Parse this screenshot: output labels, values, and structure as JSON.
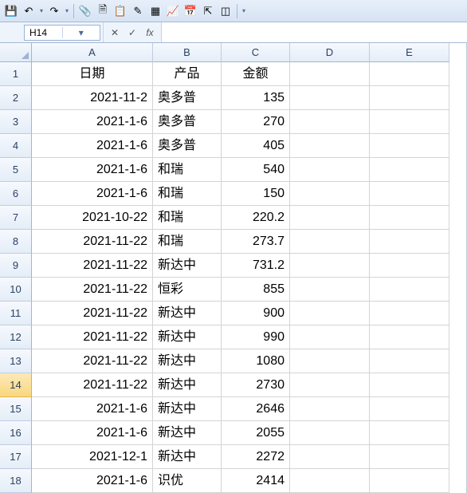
{
  "toolbar": {
    "icons": [
      "save-icon",
      "undo-icon",
      "undo-drop",
      "redo-icon",
      "redo-drop",
      "sep",
      "attach-icon",
      "new-doc-icon",
      "paste-icon",
      "rename-icon",
      "table-icon",
      "chart-icon",
      "calendar-icon",
      "export-icon",
      "template-icon",
      "sep",
      "overflow-drop"
    ]
  },
  "refbar": {
    "cell_ref": "H14",
    "fx_label": "fx",
    "formula": ""
  },
  "columns": [
    "A",
    "B",
    "C",
    "D",
    "E"
  ],
  "active_row": 14,
  "headers": {
    "A": "日期",
    "B": "产品",
    "C": "金额"
  },
  "chart_data": {
    "type": "table",
    "columns": [
      "日期",
      "产品",
      "金额"
    ],
    "rows": [
      {
        "日期": "2021-11-2",
        "产品": "奥多普",
        "金额": 135
      },
      {
        "日期": "2021-1-6",
        "产品": "奥多普",
        "金额": 270
      },
      {
        "日期": "2021-1-6",
        "产品": "奥多普",
        "金额": 405
      },
      {
        "日期": "2021-1-6",
        "产品": "和瑞",
        "金额": 540
      },
      {
        "日期": "2021-1-6",
        "产品": "和瑞",
        "金额": 150
      },
      {
        "日期": "2021-10-22",
        "产品": "和瑞",
        "金额": 220.2
      },
      {
        "日期": "2021-11-22",
        "产品": "和瑞",
        "金额": 273.7
      },
      {
        "日期": "2021-11-22",
        "产品": "新达中",
        "金额": 731.2
      },
      {
        "日期": "2021-11-22",
        "产品": "恒彩",
        "金额": 855
      },
      {
        "日期": "2021-11-22",
        "产品": "新达中",
        "金额": 900
      },
      {
        "日期": "2021-11-22",
        "产品": "新达中",
        "金额": 990
      },
      {
        "日期": "2021-11-22",
        "产品": "新达中",
        "金额": 1080
      },
      {
        "日期": "2021-11-22",
        "产品": "新达中",
        "金额": 2730
      },
      {
        "日期": "2021-1-6",
        "产品": "新达中",
        "金额": 2646
      },
      {
        "日期": "2021-1-6",
        "产品": "新达中",
        "金额": 2055
      },
      {
        "日期": "2021-12-1",
        "产品": "新达中",
        "金额": 2272
      },
      {
        "日期": "2021-1-6",
        "产品": "识优",
        "金额": 2414
      }
    ]
  }
}
